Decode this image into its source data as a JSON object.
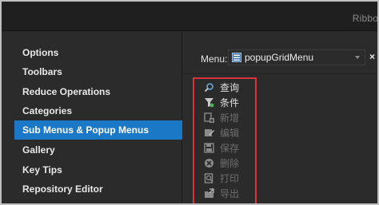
{
  "window": {
    "ribbon_label": "Ribbon"
  },
  "sidebar": {
    "items": [
      {
        "label": "Options",
        "selected": false
      },
      {
        "label": "Toolbars",
        "selected": false
      },
      {
        "label": "Reduce Operations",
        "selected": false
      },
      {
        "label": "Categories",
        "selected": false
      },
      {
        "label": "Sub Menus & Popup Menus",
        "selected": true
      },
      {
        "label": "Gallery",
        "selected": false
      },
      {
        "label": "Key Tips",
        "selected": false
      },
      {
        "label": "Repository Editor",
        "selected": false
      }
    ]
  },
  "menu": {
    "label": "Menu:",
    "value": "popupGridMenu",
    "icon": "popup-menu-icon",
    "clear": "×"
  },
  "popup": {
    "items": [
      {
        "label": "查询",
        "icon": "query-icon",
        "enabled": true
      },
      {
        "label": "条件",
        "icon": "filter-icon",
        "enabled": true
      },
      {
        "label": "新增",
        "icon": "add-icon",
        "enabled": false
      },
      {
        "label": "编辑",
        "icon": "edit-icon",
        "enabled": false
      },
      {
        "label": "保存",
        "icon": "save-icon",
        "enabled": false
      },
      {
        "label": "删除",
        "icon": "delete-icon",
        "enabled": false
      },
      {
        "label": "打印",
        "icon": "print-icon",
        "enabled": false
      },
      {
        "label": "导出",
        "icon": "export-icon",
        "enabled": false
      }
    ]
  },
  "colors": {
    "selected_bg": "#1b78c7",
    "popup_border": "#d9343a",
    "panel_bg": "#2b2b2b"
  }
}
